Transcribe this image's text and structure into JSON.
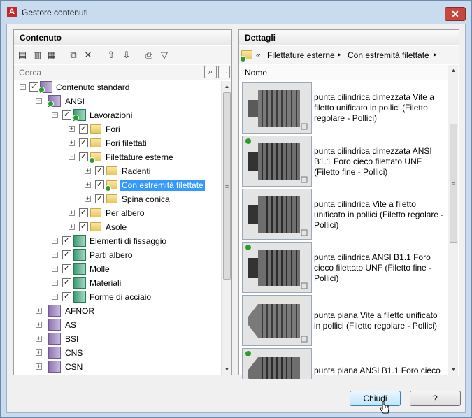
{
  "window": {
    "title": "Gestore contenuti",
    "close_glyph": "✕",
    "app_icon": "A"
  },
  "content_panel": {
    "header": "Contenuto",
    "search": {
      "placeholder": "Cerca",
      "more_label": "..."
    },
    "toolbar_icons": [
      "new-library-icon",
      "new-category-icon",
      "properties-icon",
      "copy-icon",
      "delete-icon",
      "move-up-icon",
      "move-down-icon",
      "publish-icon",
      "filter-icon"
    ],
    "tree": [
      {
        "label": "Contenuto standard"
      },
      {
        "label": "ANSI"
      },
      {
        "label": "Lavorazioni"
      },
      {
        "label": "Fori"
      },
      {
        "label": "Fori filettati"
      },
      {
        "label": "Filettature esterne"
      },
      {
        "label": "Radenti"
      },
      {
        "label": "Con estremità filettate"
      },
      {
        "label": "Spina conica"
      },
      {
        "label": "Per albero"
      },
      {
        "label": "Asole"
      },
      {
        "label": "Elementi di fissaggio"
      },
      {
        "label": "Parti albero"
      },
      {
        "label": "Molle"
      },
      {
        "label": "Materiali"
      },
      {
        "label": "Forme di acciaio"
      },
      {
        "label": "AFNOR"
      },
      {
        "label": "AS"
      },
      {
        "label": "BSI"
      },
      {
        "label": "CNS"
      },
      {
        "label": "CSN"
      }
    ]
  },
  "details_panel": {
    "header": "Dettagli",
    "breadcrumb": {
      "back": "«",
      "part1": "Filettature esterne",
      "sep1": "▸",
      "part2": "Con estremità filettate",
      "sep2": "▸"
    },
    "column": "Nome",
    "items": [
      {
        "name": "punta cilindrica dimezzata Vite a filetto unificato in pollici (Filetto regolare - Pollici)"
      },
      {
        "name": "punta cilindrica dimezzata ANSI B1.1 Foro cieco filettato UNF (Filetto fine - Pollici)"
      },
      {
        "name": "punta cilindrica Vite a filetto unificato in pollici (Filetto regolare - Pollici)"
      },
      {
        "name": "punta cilindrica ANSI B1.1 Foro cieco filettato UNF (Filetto fine - Pollici)"
      },
      {
        "name": "punta piana Vite a filetto unificato in pollici (Filetto regolare - Pollici)"
      },
      {
        "name": "punta piana ANSI B1.1 Foro cieco"
      }
    ]
  },
  "buttons": {
    "close": "Chiudi",
    "help": "?"
  }
}
